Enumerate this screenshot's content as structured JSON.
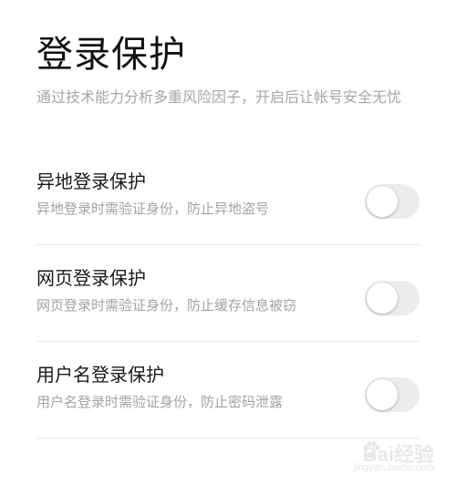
{
  "header": {
    "title": "登录保护",
    "description": "通过技术能力分析多重风险因子，开启后让帐号安全无忧"
  },
  "settings": [
    {
      "title": "异地登录保护",
      "subtitle": "异地登录时需验证身份，防止异地盗号",
      "enabled": false
    },
    {
      "title": "网页登录保护",
      "subtitle": "网页登录时需验证身份，防止缓存信息被窃",
      "enabled": false
    },
    {
      "title": "用户名登录保护",
      "subtitle": "用户名登录时需验证身份，防止密码泄露",
      "enabled": false
    }
  ],
  "watermark": {
    "brand": "Bai经验",
    "url": "jingyan.baidu.com"
  },
  "colors": {
    "toggle_off_track": "#ececec",
    "toggle_knob": "#ffffff",
    "subtitle_text": "#a3a3a3",
    "divider": "#e9e9e9"
  }
}
